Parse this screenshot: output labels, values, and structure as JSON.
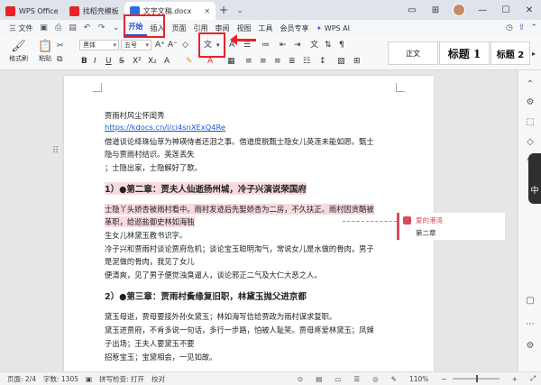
{
  "tabs": [
    {
      "label": "WPS Office",
      "color": "#e8232a"
    },
    {
      "label": "找稻壳模板",
      "color": "#e8232a"
    },
    {
      "label": "文字文稿.docx",
      "color": "#2b6de0"
    }
  ],
  "menu": {
    "file": "三 文件",
    "items": [
      "开始",
      "插入",
      "页面",
      "引用",
      "审阅",
      "视图",
      "工具",
      "会员专享"
    ],
    "active_index": 0,
    "wps_ai": "WPS AI"
  },
  "ribbon": {
    "format_painter": "格式刷",
    "paste": "粘贴",
    "font_name": "黑体",
    "font_size": "五号",
    "styles": [
      "正文",
      "标题 1",
      "标题 2"
    ]
  },
  "document": {
    "lines": [
      "贾雨村风尘怀闺秀",
      "https://kdocs.cn/l/ci4snXExQ4Re",
      "借道谈论绛珠仙草为神瑛侍者还泪之事。借道度脱甄士隐女儿英莲未能如愿。甄士",
      "隐与贾雨村结识。英莲丢失",
      "；士隐出家，士隐解好了歌。",
      "1）●第二章：贾夫人仙逝扬州城，冷子兴演说荣国府",
      "士隐丫头娇杏被雨村看中。雨村发迹后先娶娇杏为二房，不久扶正。雨村因贪酷被",
      "革职，给巡盐御史林如海独",
      "生女儿林黛玉教书识字。",
      "冷子兴和贾雨村谈论贾府危机；谈论宝玉聪明淘气，常说女儿是水做的骨肉，男子",
      "是泥做的骨肉，我见了女儿",
      "便清爽，见了男子便觉浊臭逼人，谈论邪正二气及大仁大恶之人。",
      "2）●第三章：贾雨村夤缘复旧职，林黛玉抛父进京都",
      "黛玉母逝，贾母要接外孙女黛玉；林如海写信给贾政为雨村谋求复职。",
      "黛玉进贾府，不肯多说一句话，多行一步路，怕被人耻笑。贾母疼爱林黛玉；凤辣",
      "子出场；王夫人要黛玉不要",
      "招惹宝玉；宝黛相会，一见如故。"
    ]
  },
  "comment": {
    "author": "爱的港湾",
    "text": "第二章",
    "color": "#d64a5c"
  },
  "status": {
    "page": "页面: 2/4",
    "words": "字数: 1305",
    "spell": "拼写检查: 打开",
    "proof": "校对",
    "zoom": "110%"
  },
  "colors": {
    "accent": "#1a56d6",
    "highlight": "#f6dadd",
    "annotation_red": "#e8232a"
  }
}
